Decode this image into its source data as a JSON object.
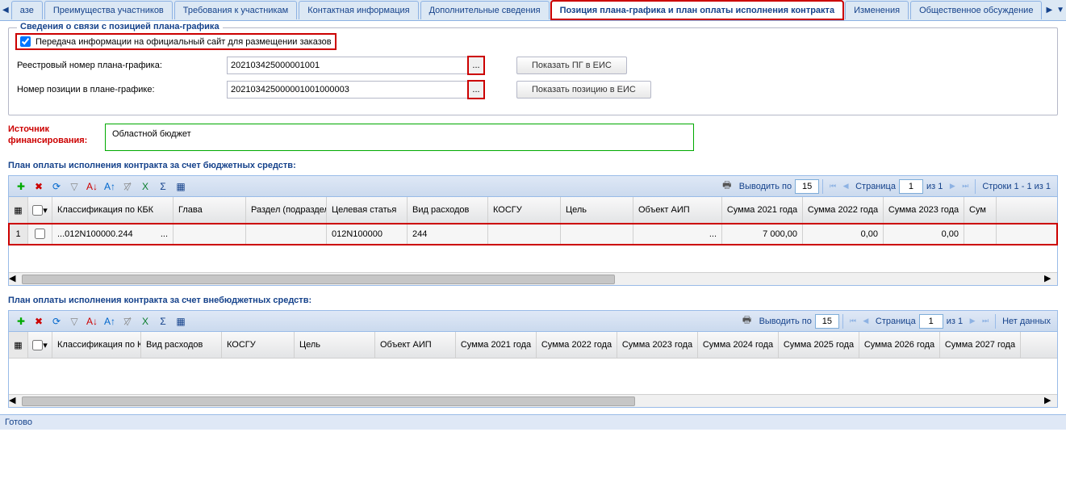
{
  "tabs": {
    "prev_partial": "азе",
    "items": [
      "Преимущества участников",
      "Требования к участникам",
      "Контактная информация",
      "Дополнительные сведения",
      "Позиция плана-графика и план оплаты исполнения контракта",
      "Изменения",
      "Общественное обсуждение"
    ],
    "active_index": 4
  },
  "fieldset": {
    "title": "Сведения о связи с позицией плана-графика",
    "checkbox_label": "Передача информации на официальный сайт для размещении заказов",
    "reg_label": "Реестровый номер плана-графика:",
    "reg_value": "202103425000001001",
    "pos_label": "Номер позиции в плане-графике:",
    "pos_value": "202103425000001001000003",
    "btn_show_pg": "Показать ПГ в ЕИС",
    "btn_show_pos": "Показать позицию в ЕИС"
  },
  "source": {
    "label": "Источник финансирования:",
    "value": "Областной бюджет"
  },
  "section1": {
    "title": "План оплаты исполнения контракта за счет бюджетных средств:",
    "paging": {
      "perpage_label": "Выводить по",
      "perpage_value": "15",
      "page_label": "Страница",
      "page_value": "1",
      "page_of": "из 1",
      "rows_info": "Строки 1 - 1 из 1"
    },
    "columns": [
      "",
      "",
      "Классификация по КБК",
      "Глава",
      "Раздел (подраздел)",
      "Целевая статья",
      "Вид расходов",
      "КОСГУ",
      "Цель",
      "Объект АИП",
      "Сумма 2021 года",
      "Сумма 2022 года",
      "Сумма 2023 года",
      "Сум"
    ],
    "row": {
      "num": "1",
      "kbk": "...012N100000.244",
      "kbk_btn": "...",
      "glava": "",
      "razdel": "",
      "statya": "012N100000",
      "vid": "244",
      "kosgu": "",
      "cel": "",
      "aip": "...",
      "s2021": "7 000,00",
      "s2022": "0,00",
      "s2023": "0,00"
    }
  },
  "section2": {
    "title": "План оплаты исполнения контракта за счет внебюджетных средств:",
    "paging": {
      "perpage_label": "Выводить по",
      "perpage_value": "15",
      "page_label": "Страница",
      "page_value": "1",
      "page_of": "из 1",
      "rows_info": "Нет данных"
    },
    "columns": [
      "",
      "",
      "Классификация по КБК",
      "Вид расходов",
      "КОСГУ",
      "Цель",
      "Объект АИП",
      "Сумма 2021 года",
      "Сумма 2022 года",
      "Сумма 2023 года",
      "Сумма 2024 года",
      "Сумма 2025 года",
      "Сумма 2026 года",
      "Сумма 2027 года"
    ]
  },
  "status": "Готово"
}
